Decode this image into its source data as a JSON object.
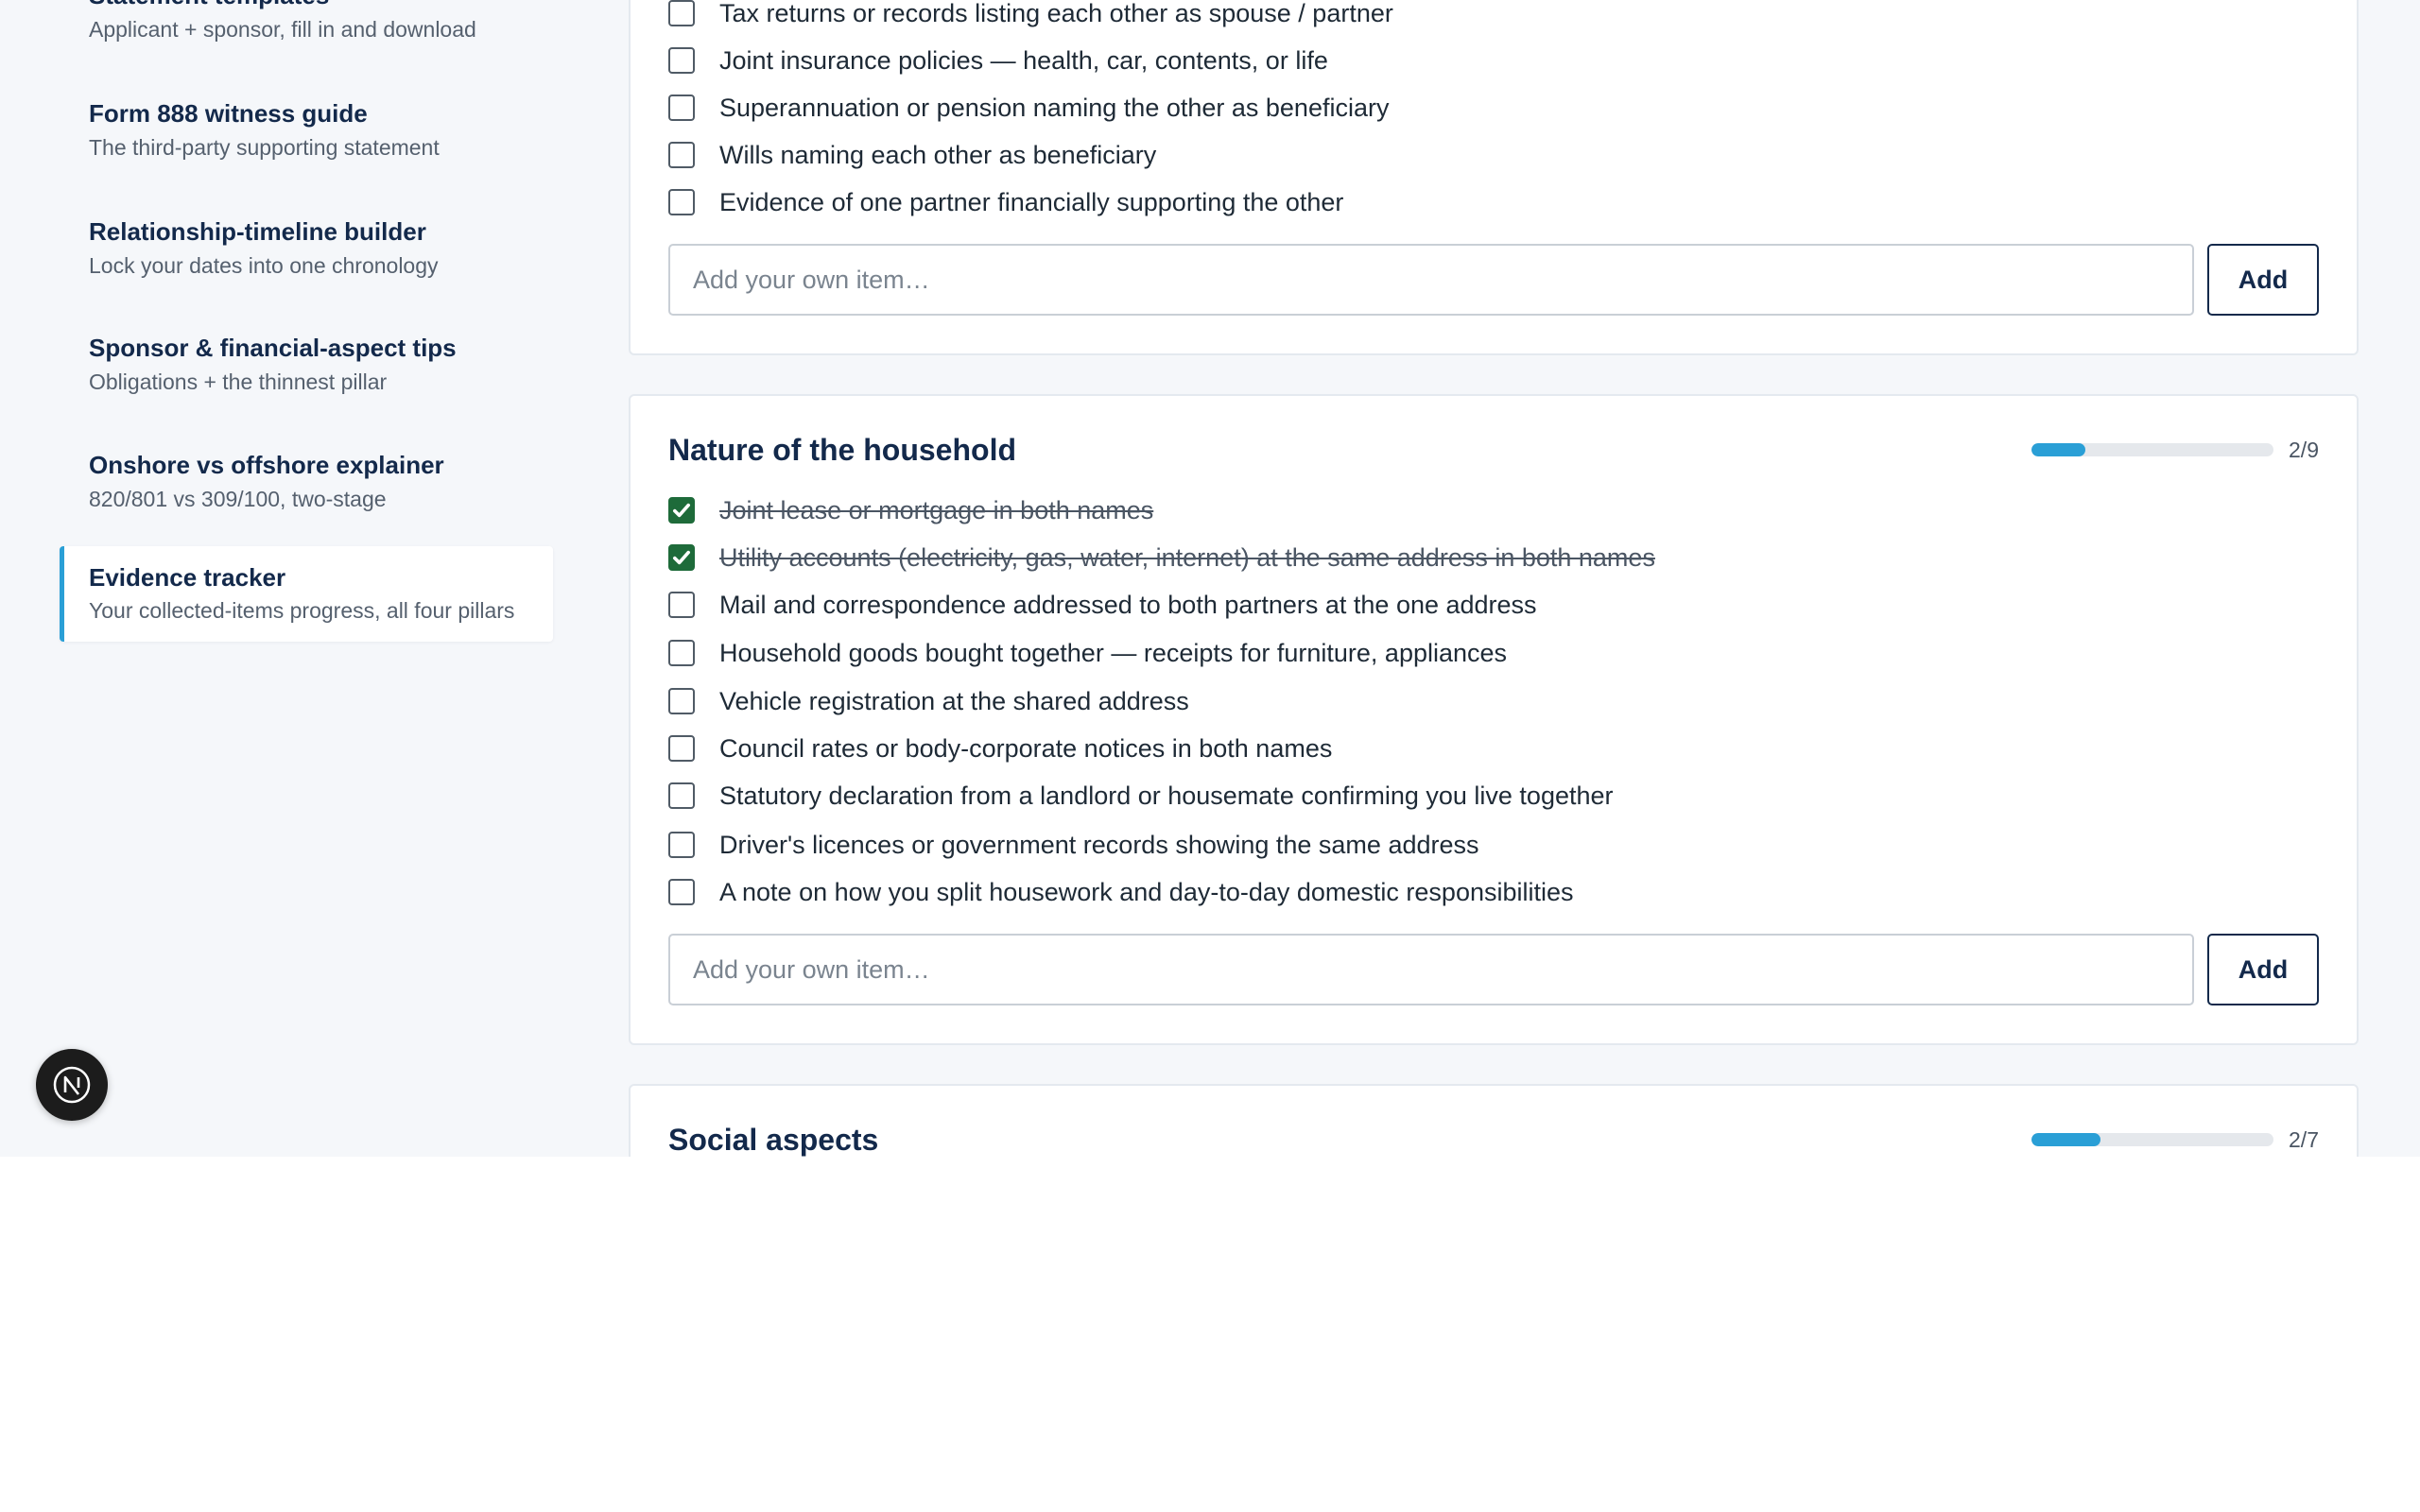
{
  "sidebar": {
    "items": [
      {
        "title": "Statement templates",
        "subtitle": "Applicant + sponsor, fill in and download"
      },
      {
        "title": "Form 888 witness guide",
        "subtitle": "The third-party supporting statement"
      },
      {
        "title": "Relationship-timeline builder",
        "subtitle": "Lock your dates into one chronology"
      },
      {
        "title": "Sponsor & financial-aspect tips",
        "subtitle": "Obligations + the thinnest pillar"
      },
      {
        "title": "Onshore vs offshore explainer",
        "subtitle": "820/801 vs 309/100, two-stage"
      },
      {
        "title": "Evidence tracker",
        "subtitle": "Your collected-items progress, all four pillars",
        "active": true
      }
    ]
  },
  "financial_section": {
    "items": [
      {
        "label": "Tax returns or records listing each other as spouse / partner",
        "checked": false
      },
      {
        "label": "Joint insurance policies — health, car, contents, or life",
        "checked": false
      },
      {
        "label": "Superannuation or pension naming the other as beneficiary",
        "checked": false
      },
      {
        "label": "Wills naming each other as beneficiary",
        "checked": false
      },
      {
        "label": "Evidence of one partner financially supporting the other",
        "checked": false
      }
    ],
    "add_placeholder": "Add your own item…",
    "add_label": "Add"
  },
  "household_section": {
    "title": "Nature of the household",
    "progress": {
      "done": 2,
      "total": 9,
      "text": "2/9"
    },
    "items": [
      {
        "label": "Joint lease or mortgage in both names",
        "checked": true
      },
      {
        "label": "Utility accounts (electricity, gas, water, internet) at the same address in both names",
        "checked": true
      },
      {
        "label": "Mail and correspondence addressed to both partners at the one address",
        "checked": false
      },
      {
        "label": "Household goods bought together — receipts for furniture, appliances",
        "checked": false
      },
      {
        "label": "Vehicle registration at the shared address",
        "checked": false
      },
      {
        "label": "Council rates or body-corporate notices in both names",
        "checked": false
      },
      {
        "label": "Statutory declaration from a landlord or housemate confirming you live together",
        "checked": false
      },
      {
        "label": "Driver's licences or government records showing the same address",
        "checked": false
      },
      {
        "label": "A note on how you split housework and day-to-day domestic responsibilities",
        "checked": false
      }
    ],
    "add_placeholder": "Add your own item…",
    "add_label": "Add"
  },
  "social_section": {
    "title": "Social aspects",
    "progress": {
      "done": 2,
      "total": 7,
      "text": "2/7"
    }
  },
  "fab": {
    "letter": "N",
    "icon": "nextjs-logo-icon"
  },
  "colors": {
    "accent": "#2a9fd6",
    "checked": "#1e6b3a",
    "navy": "#13294b",
    "page_bg": "#f5f7fa"
  }
}
